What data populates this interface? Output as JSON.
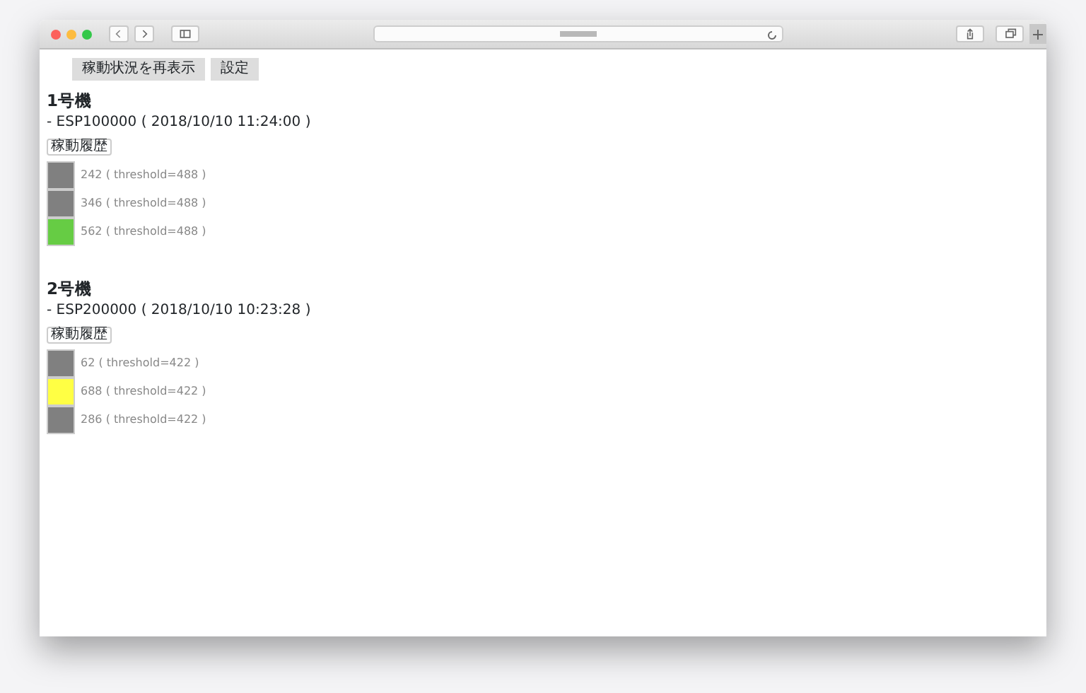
{
  "toolbar": {
    "buttons": [
      "稼動状況を再表示",
      "設定"
    ]
  },
  "machines": [
    {
      "title": "1号機",
      "device": "- ESP100000 ( 2018/10/10 11:24:00 )",
      "history_button": "稼動履歴",
      "sensors": [
        {
          "color": "#808080",
          "reading": "242 ( threshold=488 )"
        },
        {
          "color": "#808080",
          "reading": "346 ( threshold=488 )"
        },
        {
          "color": "#66cc44",
          "reading": "562 ( threshold=488 )"
        }
      ]
    },
    {
      "title": "2号機",
      "device": "- ESP200000 ( 2018/10/10 10:23:28 )",
      "history_button": "稼動履歴",
      "sensors": [
        {
          "color": "#808080",
          "reading": "62 ( threshold=422 )"
        },
        {
          "color": "#ffff44",
          "reading": "688 ( threshold=422 )"
        },
        {
          "color": "#808080",
          "reading": "286 ( threshold=422 )"
        }
      ]
    }
  ]
}
